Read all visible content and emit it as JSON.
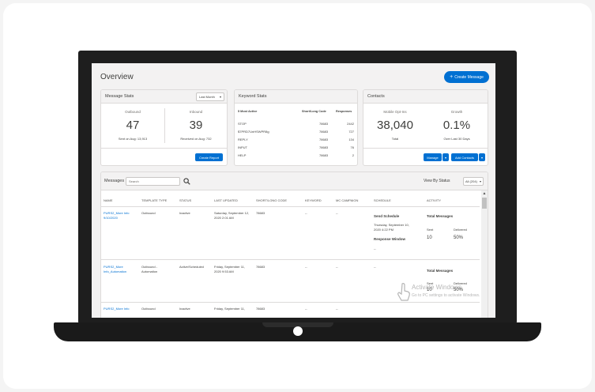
{
  "page": {
    "title": "Overview",
    "create_message": "Create Message"
  },
  "message_stats": {
    "title": "Message Stats",
    "period": "Last Month",
    "outbound_label": "Outbound",
    "outbound_value": "47",
    "outbound_sub": "Sent on Aug: 13,913",
    "inbound_label": "Inbound",
    "inbound_value": "39",
    "inbound_sub": "Received on Aug: 732",
    "create_report": "Create Report"
  },
  "keyword_stats": {
    "title": "Keyword Stats",
    "headers": [
      "5 Most Active",
      "Short/Long Code",
      "Responses"
    ],
    "rows": [
      {
        "keyword": "STOP",
        "code": "78683",
        "responses": "2442"
      },
      {
        "keyword": "$7PRD7UnHSWPR8g",
        "code": "78683",
        "responses": "727"
      },
      {
        "keyword": "REPLY",
        "code": "78683",
        "responses": "134"
      },
      {
        "keyword": "INPUT",
        "code": "78683",
        "responses": "76"
      },
      {
        "keyword": "HELP",
        "code": "78683",
        "responses": "2"
      }
    ]
  },
  "contacts": {
    "title": "Contacts",
    "optins_label": "Mobile Opt-Ins",
    "optins_value": "38,040",
    "optins_sub": "Total",
    "growth_label": "Growth",
    "growth_value": "0.1%",
    "growth_sub": "Over Last 30 Days",
    "manage": "Manage",
    "add_contacts": "Add Contacts",
    "dropdown_arrow": "▾"
  },
  "messages": {
    "title": "Messages",
    "search_placeholder": "Search",
    "view_by_status": "View By Status",
    "status_value": "All (204)",
    "columns": [
      "NAME",
      "TEMPLATE TYPE",
      "STATUS",
      "LAST UPDATED",
      "SHORT/LONG CODE",
      "KEYWORD",
      "MC CAMPAIGN",
      "SCHEDULE",
      "ACTIVITY"
    ],
    "rows": [
      {
        "name_line1": "PURS2_More Info",
        "name_line2": "9/10/2020",
        "template": "Outbound",
        "template_line2": "",
        "status": "Inactive",
        "updated_line1": "Saturday, September 12,",
        "updated_line2": "2020 2:01 AM",
        "code": "78683",
        "keyword": "--",
        "campaign": "--",
        "schedule_title": "Send Schedule",
        "schedule_line1": "Thursday, September 10,",
        "schedule_line2": "2020 4:22 PM",
        "schedule_window": "Response Window",
        "schedule_dash": "--",
        "activity_title": "Total Messages",
        "sent_label": "Sent",
        "delivered_label": "Delivered",
        "sent_value": "10",
        "delivered_value": "50%"
      },
      {
        "name_line1": "PURS2_More",
        "name_line2": "Info_Automation",
        "template": "Outbound -",
        "template_line2": "Automation",
        "status": "Active/Scheduled",
        "updated_line1": "Friday, September 11,",
        "updated_line2": "2020 9:53 AM",
        "code": "78683",
        "keyword": "--",
        "campaign": "--",
        "schedule_dash": "--",
        "activity_title": "Total Messages",
        "sent_label": "Sent",
        "delivered_label": "Delivered",
        "sent_value": "10",
        "delivered_value": "50%"
      },
      {
        "name_line1": "PURS2_More Info",
        "template": "Outbound",
        "status": "Inactive",
        "updated_line1": "Friday, September 11,",
        "code": "78683",
        "keyword": "--",
        "campaign": "--"
      }
    ]
  },
  "watermark": {
    "title": "Activate Windows",
    "subtitle": "Go to PC settings to activate Windows."
  }
}
